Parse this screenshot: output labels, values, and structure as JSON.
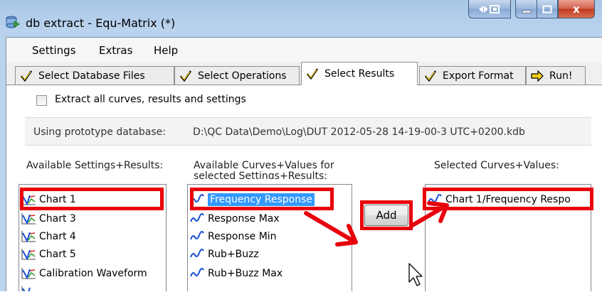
{
  "window": {
    "title": "db extract - Equ-Matrix (*)",
    "close_glyph": "x"
  },
  "menu": {
    "items": [
      "Settings",
      "Extras",
      "Help"
    ]
  },
  "tabs": [
    {
      "label": "Select Database Files",
      "icon": "check-mark-icon"
    },
    {
      "label": "Select Operations",
      "icon": "check-mark-icon"
    },
    {
      "label": "Select Results",
      "icon": "check-mark-icon",
      "active": true
    },
    {
      "label": "Export Format",
      "icon": "check-mark-icon"
    },
    {
      "label": "Run!",
      "icon": "right-arrow-icon"
    }
  ],
  "extract_all": {
    "label": "Extract all curves, results and settings",
    "checked": false
  },
  "database": {
    "label": "Using prototype database:",
    "path": "D:\\QC Data\\Demo\\Log\\DUT 2012-05-28 14-19-00-3 UTC+0200.kdb"
  },
  "settings_results": {
    "label": "Available Settings+Results:",
    "items": [
      "Chart 1",
      "Chart 3",
      "Chart 4",
      "Chart 5",
      "Calibration Waveform"
    ],
    "selected": "Chart 1"
  },
  "curves_values": {
    "label_line1": "Available Curves+Values for",
    "label_line2": "selected Settings+Results:",
    "items": [
      "Frequency Response",
      "Response Max",
      "Response Min",
      "Rub+Buzz",
      "Rub+Buzz Max"
    ],
    "selected": "Frequency Response"
  },
  "selected_curves": {
    "label": "Selected Curves+Values:",
    "items": [
      "Chart 1/Frequency Respo"
    ]
  },
  "add_button": {
    "label": "Add"
  },
  "colors": {
    "highlight": "#e8000b",
    "selection": "#3399ff"
  }
}
